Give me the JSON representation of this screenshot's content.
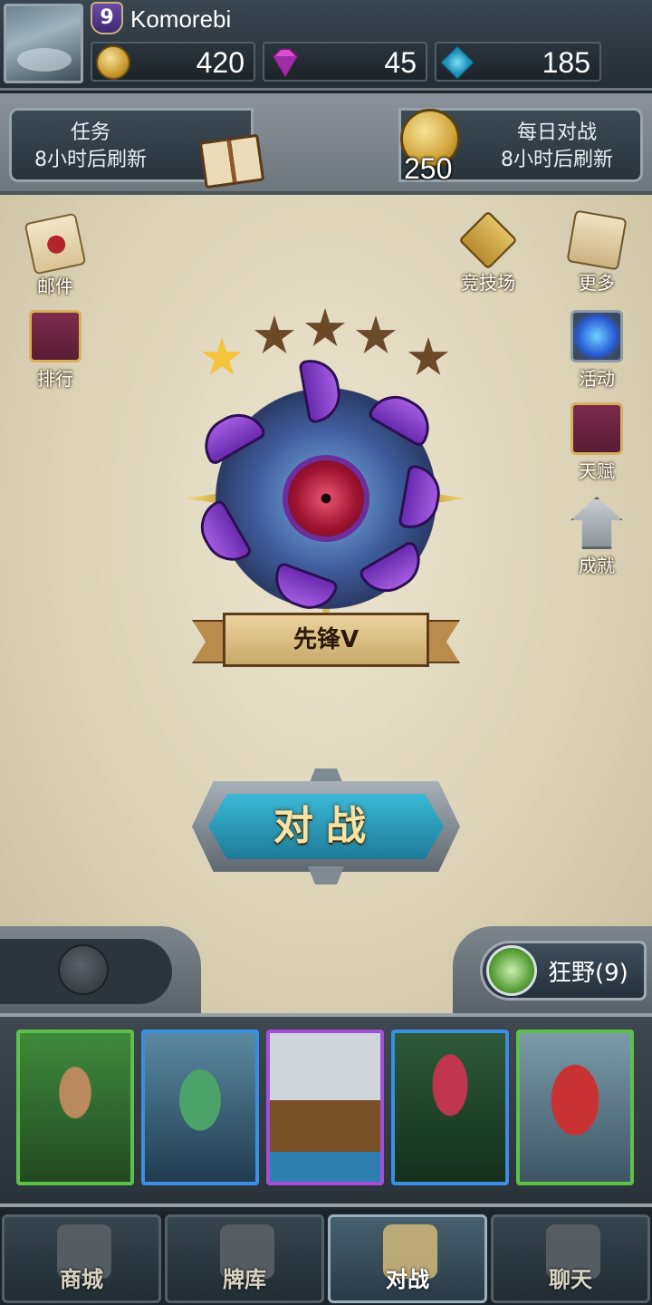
{
  "player": {
    "name": "Komorebi",
    "level": "9",
    "gold": "420",
    "gems": "45",
    "shards": "185"
  },
  "quests": {
    "title": "任务",
    "subtitle": "8小时后刷新"
  },
  "daily": {
    "title": "每日对战",
    "subtitle": "8小时后刷新",
    "reward": "250"
  },
  "side_menu": {
    "mail": "邮件",
    "rank": "排行",
    "arena": "竞技场",
    "more": "更多",
    "events": "活动",
    "talent": "天赋",
    "achievements": "成就"
  },
  "rank": {
    "title": "先锋V",
    "stars_filled": 1,
    "stars_total": 5
  },
  "battle_label": "对战",
  "deck": {
    "label": "狂野(9)"
  },
  "cards": [
    {
      "rarity": "common",
      "frame_color": "#5ec04a"
    },
    {
      "rarity": "rare",
      "frame_color": "#3b8ee0"
    },
    {
      "rarity": "epic",
      "frame_color": "#a24fd8"
    },
    {
      "rarity": "rare",
      "frame_color": "#3b8ee0"
    },
    {
      "rarity": "common",
      "frame_color": "#5ec04a"
    }
  ],
  "nav": {
    "shop": "商城",
    "collection": "牌库",
    "battle": "对战",
    "chat": "聊天",
    "active": "battle"
  }
}
